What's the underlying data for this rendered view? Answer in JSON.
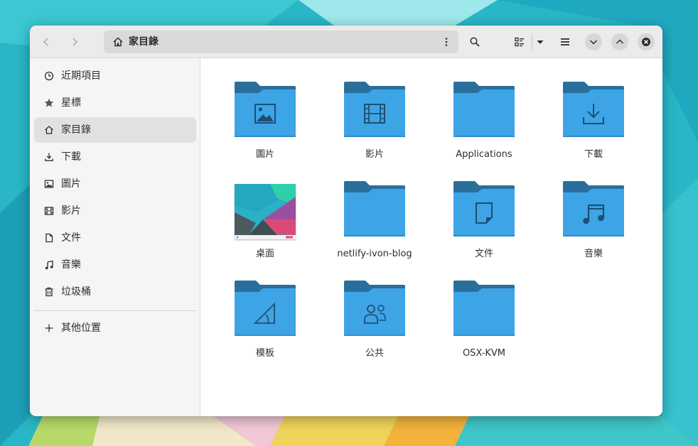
{
  "window": {
    "path": "家目錄"
  },
  "sidebar": {
    "items": [
      {
        "label": "近期項目",
        "icon": "clock-icon"
      },
      {
        "label": "星標",
        "icon": "star-icon"
      },
      {
        "label": "家目錄",
        "icon": "home-icon",
        "active": true
      },
      {
        "label": "下載",
        "icon": "download-icon"
      },
      {
        "label": "圖片",
        "icon": "image-icon"
      },
      {
        "label": "影片",
        "icon": "film-icon"
      },
      {
        "label": "文件",
        "icon": "document-icon"
      },
      {
        "label": "音樂",
        "icon": "music-icon"
      },
      {
        "label": "垃圾桶",
        "icon": "trash-icon"
      }
    ],
    "other_locations": {
      "label": "其他位置",
      "icon": "plus-icon"
    }
  },
  "files": [
    {
      "name": "圖片",
      "emblem": "image-emblem"
    },
    {
      "name": "影片",
      "emblem": "film-emblem"
    },
    {
      "name": "Applications",
      "emblem": ""
    },
    {
      "name": "下載",
      "emblem": "download-emblem"
    },
    {
      "name": "桌面",
      "emblem": "desktop-thumbnail"
    },
    {
      "name": "netlify-ivon-blog",
      "emblem": ""
    },
    {
      "name": "文件",
      "emblem": "document-emblem"
    },
    {
      "name": "音樂",
      "emblem": "music-emblem"
    },
    {
      "name": "模板",
      "emblem": "template-emblem"
    },
    {
      "name": "公共",
      "emblem": "people-emblem"
    },
    {
      "name": "OSX-KVM",
      "emblem": ""
    }
  ],
  "colors": {
    "folder_front": "#3da4e6",
    "folder_back": "#2a6f9c",
    "emblem": "#1d4f72"
  }
}
